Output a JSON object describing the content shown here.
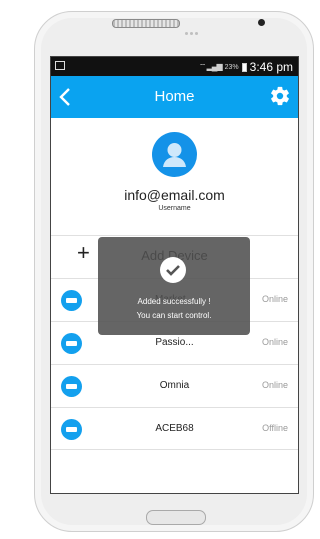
{
  "status_bar": {
    "battery": "23%",
    "time": "3:46 pm"
  },
  "header": {
    "title": "Home"
  },
  "profile": {
    "email": "info@email.com",
    "username_label": "Username"
  },
  "list": {
    "add_label": "Add Device",
    "devices": [
      {
        "name": "Market...",
        "status": "Online"
      },
      {
        "name": "Passio...",
        "status": "Online"
      },
      {
        "name": "Omnia",
        "status": "Online"
      },
      {
        "name": "ACEB68",
        "status": "Offline"
      }
    ]
  },
  "toast": {
    "line1": "Added successfully !",
    "line2": "You can start control."
  },
  "colors": {
    "accent": "#0aa3f0",
    "device_icon": "#13a0ee"
  }
}
